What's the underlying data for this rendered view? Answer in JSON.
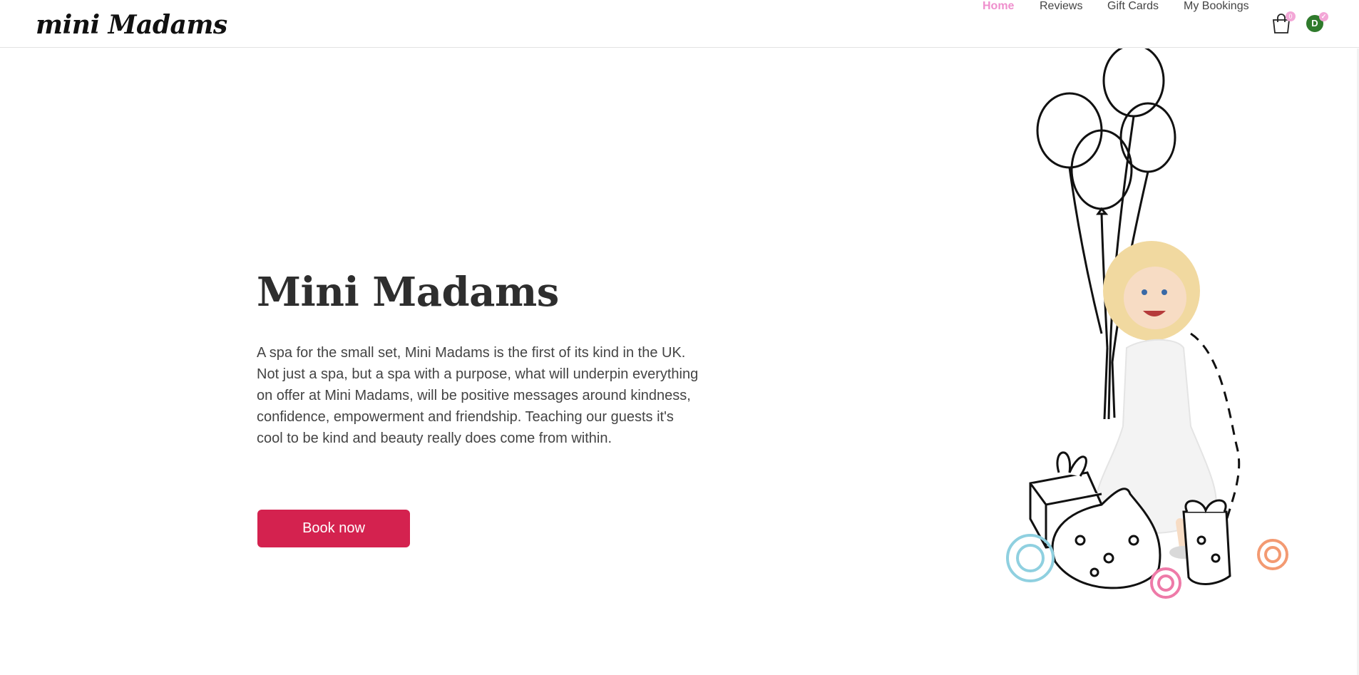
{
  "brand": {
    "logo_text": "mini Madams"
  },
  "nav": {
    "links": [
      {
        "label": "Home",
        "active": true
      },
      {
        "label": "Reviews",
        "active": false
      },
      {
        "label": "Gift Cards",
        "active": false
      },
      {
        "label": "My Bookings",
        "active": false
      }
    ],
    "cart_count": "0",
    "avatar_initial": "D"
  },
  "hero": {
    "title": "Mini Madams",
    "description": "A spa for the small set, Mini Madams is the first of its kind in the UK. Not just a spa, but a spa with a purpose, what will underpin everything on offer at Mini Madams, will be positive messages around kindness, confidence, empowerment and friendship. Teaching our guests it's cool to be kind and beauty really does come from within.",
    "cta_label": "Book now"
  },
  "colors": {
    "accent": "#d4224f",
    "nav_active": "#ef8fcd",
    "avatar_bg": "#2f7a2c",
    "badge": "#f3a7d7"
  },
  "icons": {
    "cart": "shopping-bag-icon",
    "avatar_badge": "check-icon"
  }
}
